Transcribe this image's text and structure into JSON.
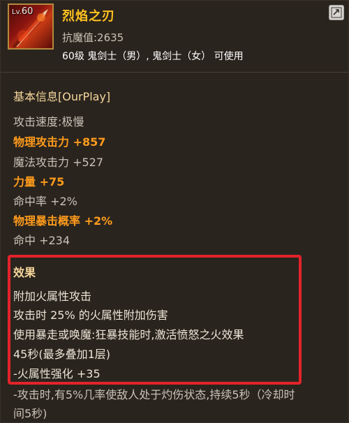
{
  "item": {
    "level_prefix": "Lv.",
    "level": "60",
    "name": "烈焰之刃",
    "resist": "抗魔值:2635",
    "usable": "60级 鬼剑士（男）, 鬼剑士（女） 可使用"
  },
  "icons": {
    "item_icon": "flame-blade-icon",
    "compare": "compare-icon"
  },
  "basic_info": {
    "title": "基本信息[OurPlay]",
    "stats": [
      {
        "text": "攻击速度:极慢",
        "highlight": false
      },
      {
        "text": "物理攻击力 +857",
        "highlight": true
      },
      {
        "text": "魔法攻击力 +527",
        "highlight": false
      },
      {
        "text": "力量 +75",
        "highlight": true
      },
      {
        "text": "命中率 +2%",
        "highlight": false
      },
      {
        "text": "物理暴击概率 +2%",
        "highlight": true
      },
      {
        "text": "命中 +234",
        "highlight": false
      }
    ]
  },
  "effects": {
    "title": "效果",
    "lines": [
      "附加火属性攻击",
      "攻击时 25% 的火属性附加伤害",
      "使用暴走或唤魔:狂暴技能时,激活愤怒之火效果",
      "45秒(最多叠加1层)",
      "-火属性强化 +35"
    ]
  },
  "footer": {
    "lines": [
      "-攻击时,有5%几率使敌人处于灼伤状态,持续5秒（冷却时",
      "间5秒)"
    ]
  },
  "colors": {
    "name": "#ffc11f",
    "highlight": "#ff9c1c",
    "section_title": "#f6d79c",
    "red_box": "#e3232a",
    "background": "#2a241e"
  }
}
